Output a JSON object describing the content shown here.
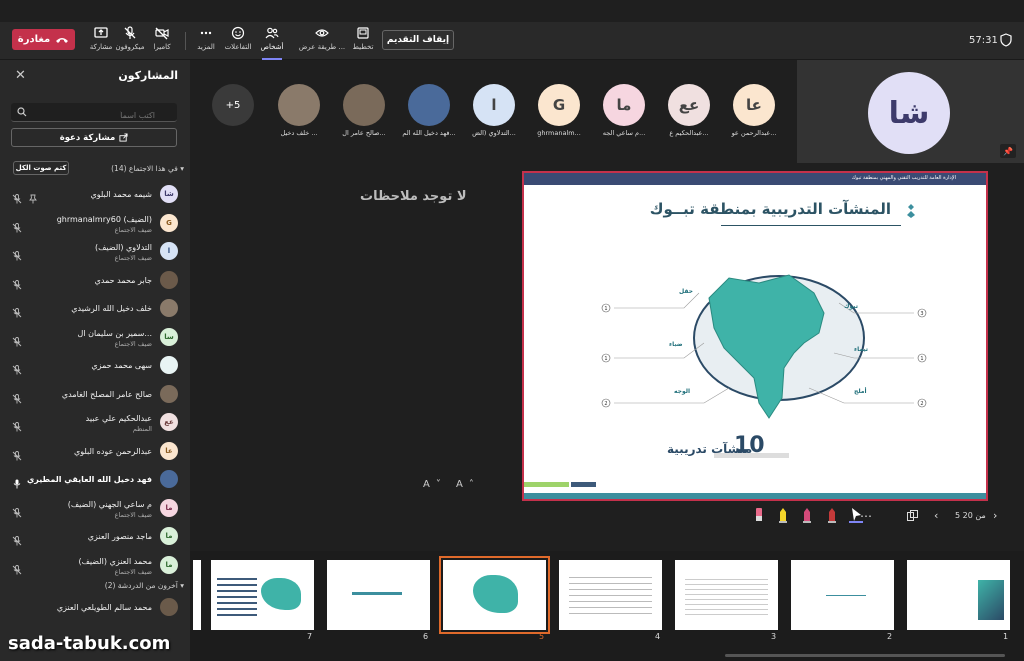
{
  "toolbar": {
    "leave_label": "مغادرة",
    "buttons": [
      {
        "label": "مشاركة"
      },
      {
        "label": "ميكروفون"
      },
      {
        "label": "كاميرا"
      },
      {
        "label": "المزيد"
      },
      {
        "label": "التفاعلات"
      },
      {
        "label": "أشخاص"
      },
      {
        "label": "طريقة عرض ..."
      },
      {
        "label": "تخطيط"
      }
    ],
    "stop_presenting_label": "إيقاف التقديم",
    "timer": "57:31",
    "accent_color": "#c4314b",
    "active_color": "#7f85f5"
  },
  "sidebar": {
    "title": "المشاركون",
    "search_placeholder": "اكتب اسماً",
    "invite_label": "مشاركة دعوة",
    "mute_all_label": "كتم صوت الكل",
    "in_meeting_header": "في هذا الاجتماع (14)",
    "others_header": "آخرون من الدردشة (2)",
    "participants": [
      {
        "initials": "شا",
        "name": "شيمه محمد البلوي",
        "sub": "",
        "avatar_bg": "#e1dff6",
        "avatar_fg": "#3d3a6b"
      },
      {
        "initials": "G",
        "name": "ghrmanalmry60 (الضيف)",
        "sub": "ضيف الاجتماع",
        "avatar_bg": "#fbe6cf",
        "avatar_fg": "#8a5a1f"
      },
      {
        "initials": "ا",
        "name": "التدلاوي (الضيف)",
        "sub": "ضيف الاجتماع",
        "avatar_bg": "#d6e3f5",
        "avatar_fg": "#2a4a7a"
      },
      {
        "initials": "",
        "name": "جابر محمد حمدي",
        "sub": "",
        "avatar_bg": "#6b5a4a",
        "avatar_fg": "#fff"
      },
      {
        "initials": "",
        "name": "خلف دخيل الله الرشيدي",
        "sub": "",
        "avatar_bg": "#8a7a6a",
        "avatar_fg": "#fff"
      },
      {
        "initials": "سا",
        "name": "سمير بن سليمان ال...",
        "sub": "ضيف الاجتماع",
        "avatar_bg": "#d9f0d9",
        "avatar_fg": "#2f6a2f"
      },
      {
        "initials": "",
        "name": "سهى محمد حمزي",
        "sub": "",
        "avatar_bg": "#e8f4f4",
        "avatar_fg": "#2f6a6a"
      },
      {
        "initials": "",
        "name": "صالح عامر المصلح الغامدي",
        "sub": "",
        "avatar_bg": "#7a6a5a",
        "avatar_fg": "#fff"
      },
      {
        "initials": "عع",
        "name": "عبدالحكيم علي عبيد",
        "sub": "المنظم",
        "avatar_bg": "#f0e0e0",
        "avatar_fg": "#6a3a3a"
      },
      {
        "initials": "عا",
        "name": "عبدالرحمن عوده البلوي",
        "sub": "",
        "avatar_bg": "#fbe6cf",
        "avatar_fg": "#8a5a1f"
      },
      {
        "initials": "",
        "name": "فهد دخيل الله العايقي المطيري",
        "sub": "",
        "avatar_bg": "#4a6a9a",
        "avatar_fg": "#fff"
      },
      {
        "initials": "ما",
        "name": "م ساعي الجهني (الضيف)",
        "sub": "ضيف الاجتماع",
        "avatar_bg": "#f6d6e0",
        "avatar_fg": "#7a2a4a"
      },
      {
        "initials": "ما",
        "name": "ماجد منصور العنزي",
        "sub": "",
        "avatar_bg": "#d9f0d9",
        "avatar_fg": "#2f6a2f"
      },
      {
        "initials": "ما",
        "name": "محمد العنزي (الضيف)",
        "sub": "ضيف الاجتماع",
        "avatar_bg": "#d9f0d9",
        "avatar_fg": "#2f6a2f"
      }
    ],
    "others": [
      {
        "initials": "",
        "name": "محمد سالم الطويلعي العنزي",
        "sub": "",
        "avatar_bg": "#6a5a4a",
        "avatar_fg": "#fff"
      }
    ]
  },
  "gallery": {
    "more_label": "+5",
    "tiles": [
      {
        "initials": "عا",
        "name": "عبدالرحمن عو...",
        "bg": "#fbe6cf"
      },
      {
        "initials": "عع",
        "name": "عبدالحكيم ع...",
        "bg": "#f0e0e0"
      },
      {
        "initials": "ما",
        "name": "م ساعي الجه...",
        "bg": "#f6d6e0"
      },
      {
        "initials": "G",
        "name": "ghrmanalm...",
        "bg": "#fbe6cf"
      },
      {
        "initials": "ا",
        "name": "التدلاوي (الض...",
        "bg": "#d6e3f5"
      },
      {
        "initials": "",
        "name": "فهد دخيل الله الم...",
        "bg": "#4a6a9a"
      },
      {
        "initials": "",
        "name": "صالح عامر ال...",
        "bg": "#7a6a5a"
      },
      {
        "initials": "",
        "name": "خلف دخيل ...",
        "bg": "#8a7a6a"
      }
    ],
    "self_initials": "شا"
  },
  "stage": {
    "no_notes": "لا توجد ملاحظات",
    "font_controls": "A˅ A˄",
    "slide": {
      "header": "الإدارة العامة للتدريب التقني والمهني بمنطقة تبوك",
      "title": "المنشآت التدريبية بمنطقة تبــوك",
      "count": "10",
      "count_label": "منشآت تدريبية",
      "regions": [
        "تبوك",
        "حقل",
        "ضباء",
        "تيماء",
        "الوجه",
        "أملج"
      ],
      "region_counts": [
        "3",
        "1",
        "1",
        "1",
        "2",
        "2"
      ]
    },
    "pager": "5 من 20"
  },
  "filmstrip": {
    "numbers": [
      "1",
      "2",
      "3",
      "4",
      "5",
      "6",
      "7"
    ],
    "selected_index": 4
  },
  "watermark": "sada-tabuk.com"
}
